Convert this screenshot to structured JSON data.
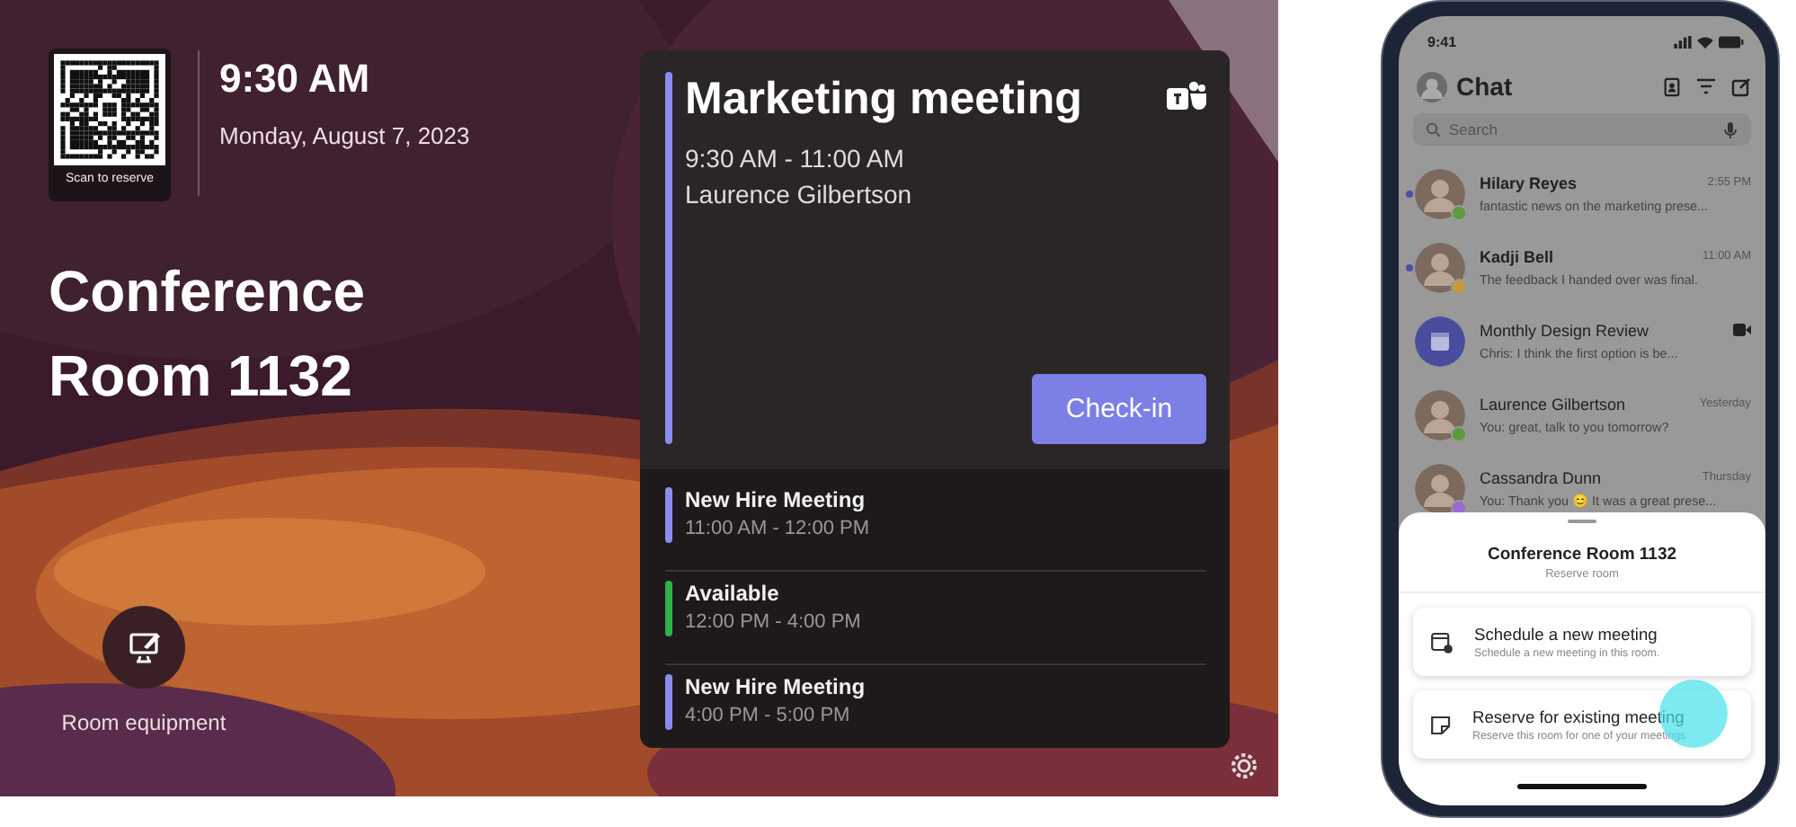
{
  "room_display": {
    "qr": {
      "caption": "Scan to reserve"
    },
    "time": "9:30 AM",
    "date": "Monday, August 7, 2023",
    "room_name": "Conference Room 1132",
    "equipment_button": {
      "label": "Room equipment"
    },
    "current_meeting": {
      "title": "Marketing meeting",
      "time": "9:30 AM - 11:00 AM",
      "organizer": "Laurence Gilbertson",
      "color": "#8b8cf0",
      "button": "Check-in"
    },
    "agenda": [
      {
        "title": "New Hire Meeting",
        "time": "11:00 AM - 12:00 PM",
        "color": "#8b8cf0"
      },
      {
        "title": "Available",
        "time": "12:00 PM - 4:00 PM",
        "color": "#2fb14c"
      },
      {
        "title": "New Hire Meeting",
        "time": "4:00 PM - 5:00 PM",
        "color": "#8b8cf0"
      }
    ]
  },
  "phone": {
    "status_time": "9:41",
    "title": "Chat",
    "search": {
      "placeholder": "Search"
    },
    "chats": [
      {
        "kind": "person",
        "name": "Hilary Reyes",
        "preview": "fantastic news on the marketing prese...",
        "time": "2:55 PM",
        "unread": true,
        "color": "#5c9a3c"
      },
      {
        "kind": "person",
        "name": "Kadji Bell",
        "preview": "The feedback I handed over was final.",
        "time": "11:00 AM",
        "unread": true,
        "color": "#c89a3a"
      },
      {
        "kind": "meeting",
        "name": "Monthly Design Review",
        "preview": "Chris: I think the first option is be...",
        "unread": false
      },
      {
        "kind": "person",
        "name": "Laurence Gilbertson",
        "preview": "You: great, talk to you tomorrow?",
        "time": "Yesterday",
        "unread": false,
        "color": "#5c9a3c"
      },
      {
        "kind": "person",
        "name": "Cassandra Dunn",
        "preview": "You: Thank you 😊 It was a great prese...",
        "time": "Thursday",
        "unread": false,
        "color": "#9a6ad0"
      }
    ],
    "sheet": {
      "title": "Conference Room 1132",
      "subtitle": "Reserve room",
      "options": [
        {
          "kind": "schedule",
          "title": "Schedule a new meeting",
          "description": "Schedule a new meeting in this room."
        },
        {
          "kind": "reserve",
          "title": "Reserve for existing meeting",
          "description": "Reserve this room for one of your meetings"
        }
      ]
    }
  }
}
